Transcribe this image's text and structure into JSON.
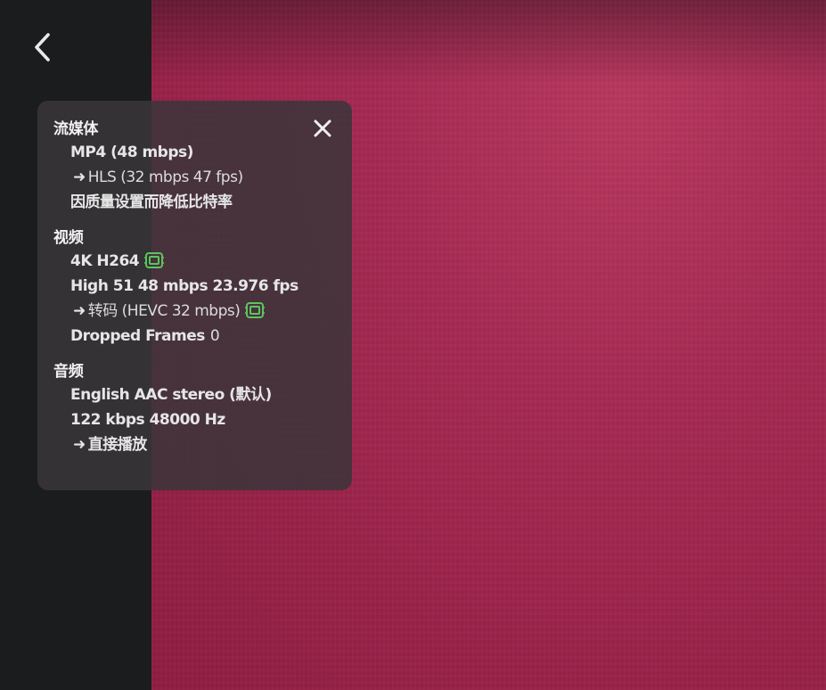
{
  "colors": {
    "sidebar_bg": "#1b1c1e",
    "video_bg": "#a72b54",
    "panel_bg": "rgba(58,54,58,0.86)",
    "text": "#e6e6e6",
    "hw_badge": "#5cc45c"
  },
  "icons": {
    "back": "chevron-left-icon",
    "close": "close-icon",
    "hardware_accel": "chip-icon"
  },
  "stream": {
    "title": "流媒体",
    "container": "MP4 (48 mbps)",
    "transcode_arrow": "➜",
    "transcode_target": "HLS (32 mbps 47 fps)",
    "reason": "因质量设置而降低比特率"
  },
  "video": {
    "title": "视频",
    "resolution_codec": "4K H264",
    "profile_line": "High 51 48 mbps 23.976 fps",
    "transcode_arrow": "➜",
    "transcode_target": "转码 (HEVC 32 mbps)",
    "dropped_label": "Dropped Frames",
    "dropped_value": "0"
  },
  "audio": {
    "title": "音频",
    "track": "English AAC stereo (默认)",
    "bitrate_line": "122 kbps 48000 Hz",
    "transcode_arrow": "➜",
    "transcode_target": "直接播放"
  }
}
